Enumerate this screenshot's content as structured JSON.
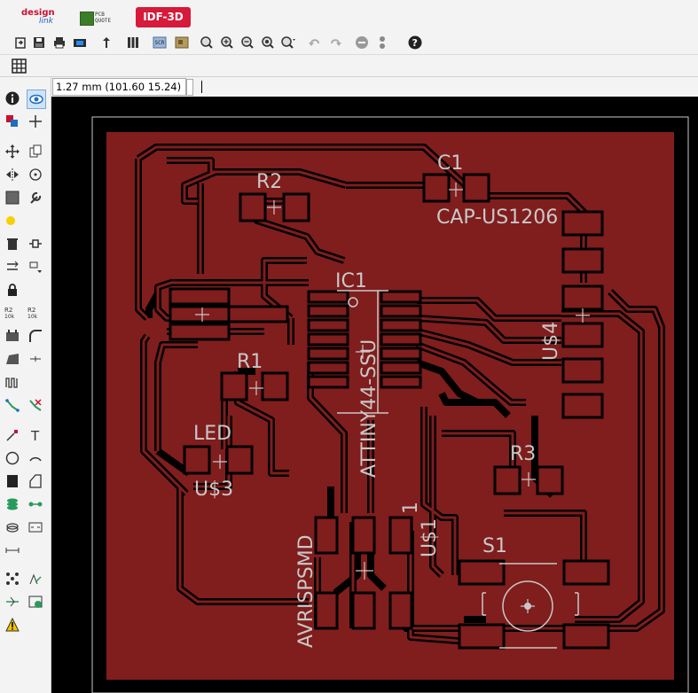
{
  "window": {
    "title": ""
  },
  "top_tabs": [
    {
      "id": "designlink",
      "line1": "design",
      "line2": "link"
    },
    {
      "id": "pcbquote",
      "line1": "PCB",
      "line2": "QUOTE"
    },
    {
      "id": "idf3d",
      "label": "IDF-3D"
    }
  ],
  "toolbar_icons": [
    "open-icon",
    "save-icon",
    "print-icon",
    "cam-icon",
    "upload-icon",
    "layer-settings-icon",
    "script-icon",
    "run-ulp-icon",
    "zoom-fit-icon",
    "zoom-in-icon",
    "zoom-out-icon",
    "zoom-redraw-icon",
    "zoom-select-icon",
    "undo-icon",
    "redo-icon",
    "stop-icon",
    "go-icon",
    "help-icon"
  ],
  "toolbar2_icons": [
    "grid-icon"
  ],
  "coordinate": {
    "value": "1.27 mm (101.60 15.24)"
  },
  "command_line": {
    "value": ""
  },
  "left_tools": [
    "info-icon",
    "show-icon",
    "display-icon",
    "mark-icon",
    "move-icon",
    "copy-icon",
    "mirror-icon",
    "rotate-icon",
    "group-icon",
    "change-icon",
    "paste-icon",
    "delete-icon",
    "add-icon",
    "replace-icon",
    "lock-icon",
    "smash-icon",
    "name-icon",
    "value-icon",
    "split-icon",
    "miter-icon",
    "optimize-icon",
    "meander-icon",
    "route-icon",
    "ripup-icon",
    "wire-icon",
    "text-icon",
    "circle-icon",
    "arc-icon",
    "rect-icon",
    "polygon-icon",
    "via-icon",
    "signal-icon",
    "hole-icon",
    "attribute-icon",
    "dimension-icon",
    "ratsnest-icon",
    "autorouter-icon",
    "erc-icon",
    "drc-icon",
    "errors-icon"
  ],
  "pcb_labels": {
    "r2": "R2",
    "c1": "C1",
    "cap": "CAP-US1206",
    "ic1": "IC1",
    "attiny": "ATTINY44-SSU",
    "us4": "U$4",
    "r1": "R1",
    "led": "LED",
    "us3": "U$3",
    "r3": "R3",
    "avr": "AVRISPSMD",
    "one": "1",
    "us1": "U$1",
    "s1": "S1"
  },
  "colors": {
    "board": "#801d1d",
    "board_outline": "#c8c8c8",
    "background": "#000000",
    "silkscreen": "#c8c8c8",
    "accent_tab": "#d7193a"
  }
}
